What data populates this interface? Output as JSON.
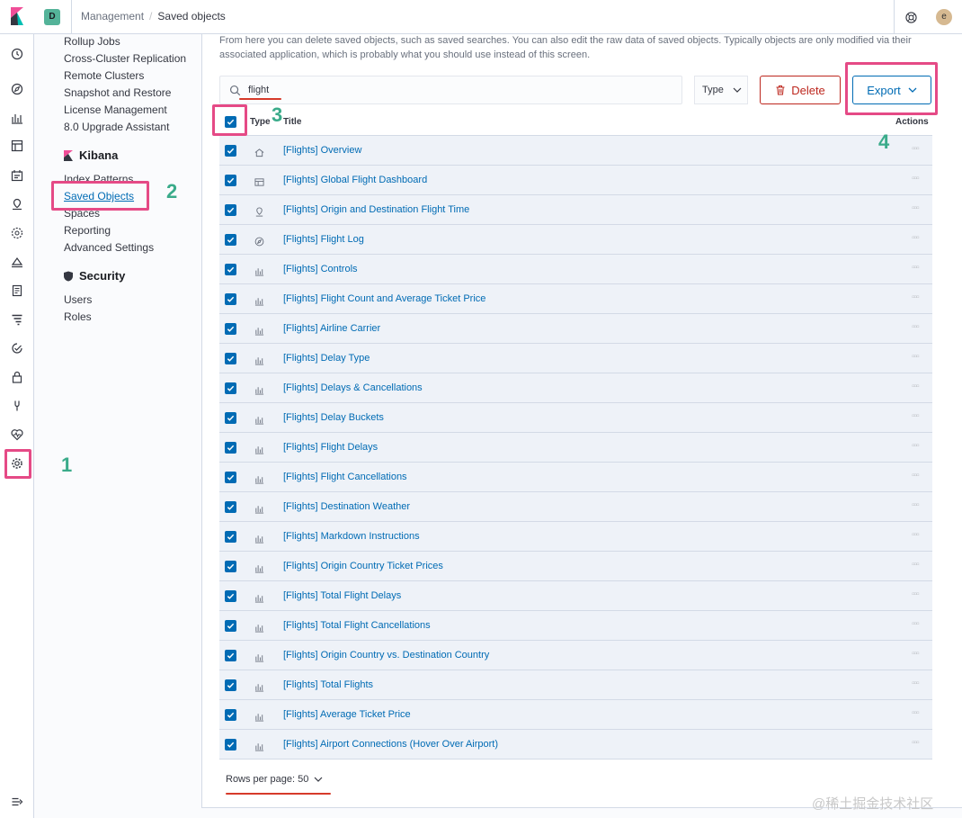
{
  "header": {
    "space_badge": "D",
    "breadcrumbs": [
      "Management",
      "Saved objects"
    ],
    "avatar_initial": "e"
  },
  "sidenav": {
    "elasticsearch_items": [
      "Rollup Jobs",
      "Cross-Cluster Replication",
      "Remote Clusters",
      "Snapshot and Restore",
      "License Management",
      "8.0 Upgrade Assistant"
    ],
    "kibana_heading": "Kibana",
    "kibana_items": [
      "Index Patterns",
      "Saved Objects",
      "Spaces",
      "Reporting",
      "Advanced Settings"
    ],
    "security_heading": "Security",
    "security_items": [
      "Users",
      "Roles"
    ]
  },
  "main": {
    "intro": "From here you can delete saved objects, such as saved searches. You can also edit the raw data of saved objects. Typically objects are only modified via their associated application, which is probably what you should use instead of this screen.",
    "search_value": "flight",
    "type_filter_label": "Type",
    "delete_label": "Delete",
    "export_label": "Export",
    "columns": {
      "type": "Type",
      "title": "Title",
      "actions": "Actions"
    },
    "rows": [
      {
        "icon": "dashboard",
        "title": "[Flights] Overview"
      },
      {
        "icon": "dashboard-canvas",
        "title": "[Flights] Global Flight Dashboard"
      },
      {
        "icon": "map",
        "title": "[Flights] Origin and Destination Flight Time"
      },
      {
        "icon": "discover",
        "title": "[Flights] Flight Log"
      },
      {
        "icon": "visualize",
        "title": "[Flights] Controls"
      },
      {
        "icon": "visualize",
        "title": "[Flights] Flight Count and Average Ticket Price"
      },
      {
        "icon": "visualize",
        "title": "[Flights] Airline Carrier"
      },
      {
        "icon": "visualize",
        "title": "[Flights] Delay Type"
      },
      {
        "icon": "visualize",
        "title": "[Flights] Delays & Cancellations"
      },
      {
        "icon": "visualize",
        "title": "[Flights] Delay Buckets"
      },
      {
        "icon": "visualize",
        "title": "[Flights] Flight Delays"
      },
      {
        "icon": "visualize",
        "title": "[Flights] Flight Cancellations"
      },
      {
        "icon": "visualize",
        "title": "[Flights] Destination Weather"
      },
      {
        "icon": "visualize",
        "title": "[Flights] Markdown Instructions"
      },
      {
        "icon": "visualize",
        "title": "[Flights] Origin Country Ticket Prices"
      },
      {
        "icon": "visualize",
        "title": "[Flights] Total Flight Delays"
      },
      {
        "icon": "visualize",
        "title": "[Flights] Total Flight Cancellations"
      },
      {
        "icon": "visualize",
        "title": "[Flights] Origin Country vs. Destination Country"
      },
      {
        "icon": "visualize",
        "title": "[Flights] Total Flights"
      },
      {
        "icon": "visualize",
        "title": "[Flights] Average Ticket Price"
      },
      {
        "icon": "visualize",
        "title": "[Flights] Airport Connections (Hover Over Airport)"
      }
    ],
    "rows_per_page": "Rows per page: 50"
  },
  "annotations": [
    "1",
    "2",
    "3",
    "4"
  ],
  "watermark": "@稀土掘金技术社区",
  "colors": {
    "accent": "#006bb4",
    "danger": "#bd271e",
    "highlight": "#e54a86",
    "number": "#3aab8a"
  }
}
